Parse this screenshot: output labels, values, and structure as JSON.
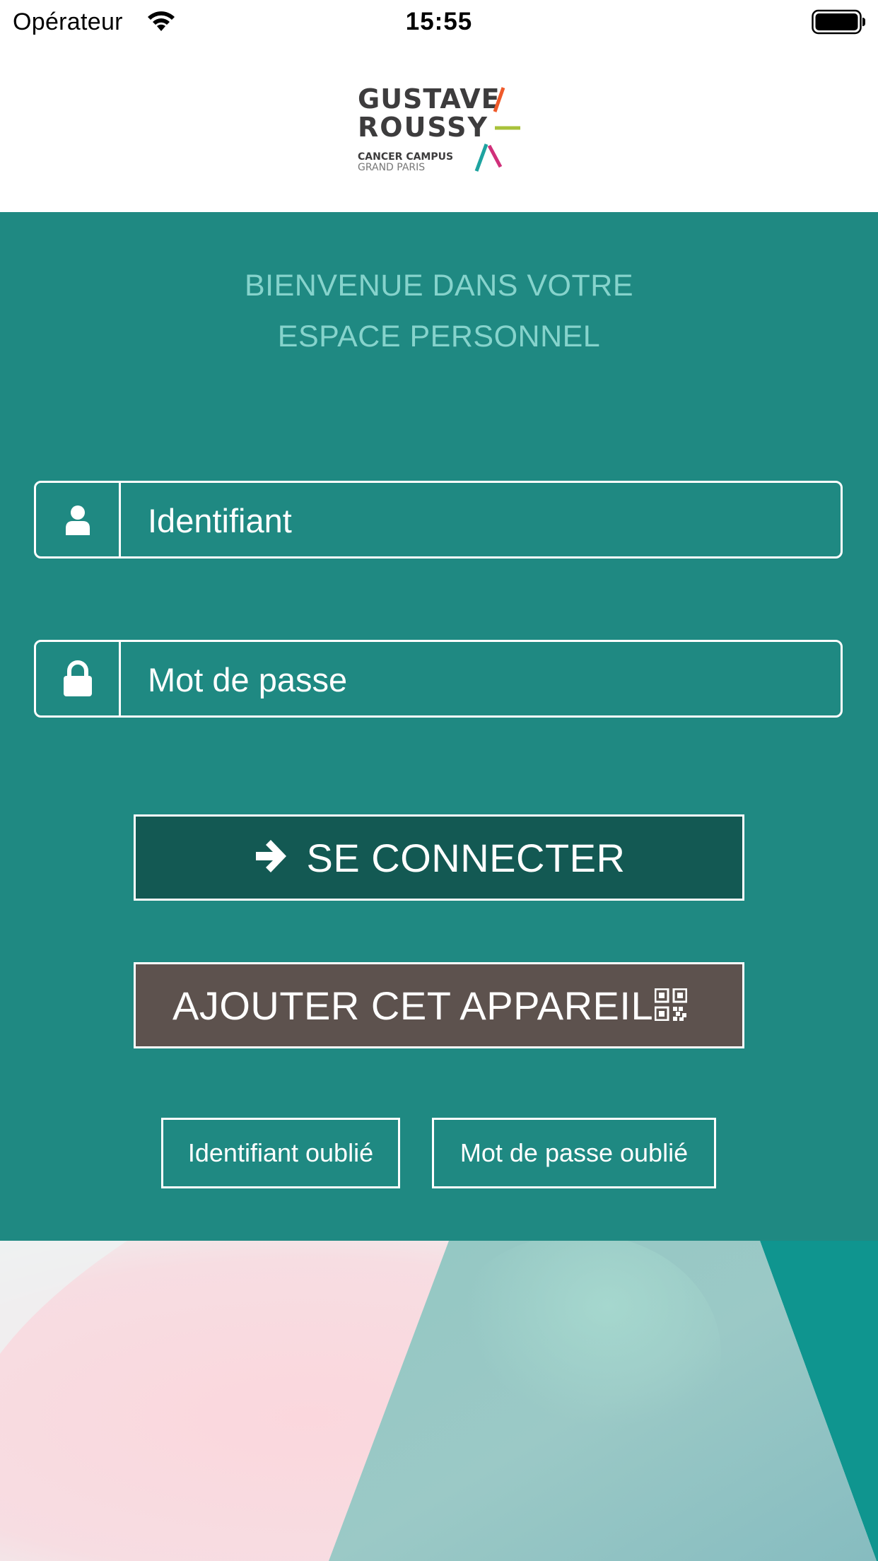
{
  "status_bar": {
    "carrier": "Opérateur",
    "time": "15:55"
  },
  "logo": {
    "line1": "GUSTAVE",
    "line2": "ROUSSY",
    "line3": "CANCER CAMPUS",
    "line4": "GRAND PARIS",
    "accent_colors": [
      "#ef5a2a",
      "#a8c23a",
      "#1ea3a0",
      "#d0307a"
    ]
  },
  "welcome": {
    "line1": "BIENVENUE DANS VOTRE",
    "line2": "ESPACE PERSONNEL"
  },
  "form": {
    "username_placeholder": "Identifiant",
    "password_placeholder": "Mot de passe",
    "username_icon": "user-icon",
    "password_icon": "lock-icon"
  },
  "buttons": {
    "connect_label": "SE CONNECTER",
    "connect_icon": "arrow-right-icon",
    "add_device_label": "AJOUTER CET APPAREIL",
    "add_device_icon": "qr-code-icon",
    "forgot_username_label": "Identifiant oublié",
    "forgot_password_label": "Mot de passe oublié"
  },
  "colors": {
    "panel": "#1f8982",
    "welcome_text": "#86d3cc",
    "connect_button": "#135953",
    "add_device_button": "#5d524e"
  }
}
